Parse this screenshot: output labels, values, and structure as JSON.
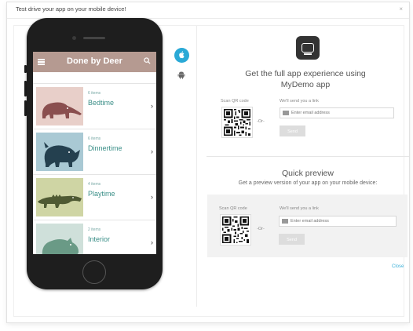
{
  "modal": {
    "title": "Test drive your app on your mobile device!",
    "close_label": "×"
  },
  "phone_app": {
    "title": "Done by Deer",
    "items": [
      {
        "count": "6 items",
        "name": "Bedtime",
        "color": "#e8cfc9",
        "animal": "anteater"
      },
      {
        "count": "6 items",
        "name": "Dinnertime",
        "color": "#a9c9d4",
        "animal": "rhino"
      },
      {
        "count": "4 items",
        "name": "Playtime",
        "color": "#cfd5a4",
        "animal": "crocodile"
      },
      {
        "count": "2 items",
        "name": "Interior",
        "color": "#cfe0da",
        "animal": "hippo"
      }
    ]
  },
  "platforms": {
    "ios_icon": "apple-icon",
    "android_icon": "android-icon",
    "active": "ios",
    "accent": "#2aa9d6"
  },
  "full_app": {
    "title_line1": "Get the full app experience using",
    "title_line2": "MyDemo app",
    "scan_label": "Scan QR code",
    "or_label": "-Or-",
    "send_label_text": "We'll send you a link",
    "email_placeholder": "Enter email address",
    "send_button": "Send"
  },
  "quick_preview": {
    "title": "Quick preview",
    "subtitle": "Get a preview version of your app on your mobile device:",
    "scan_label": "Scan QR code",
    "or_label": "-Or-",
    "send_label_text": "We'll send you a link",
    "email_placeholder": "Enter email address",
    "send_button": "Send"
  },
  "footer": {
    "close_link": "Close"
  }
}
